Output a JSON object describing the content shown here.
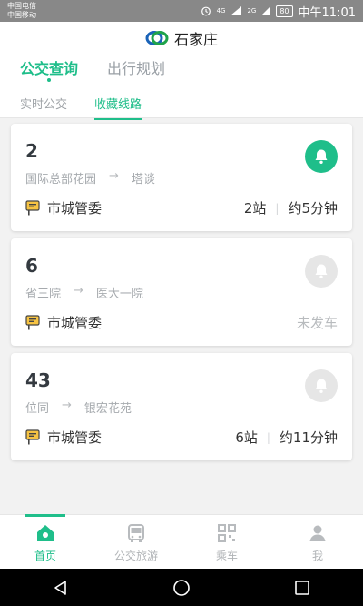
{
  "statusbar": {
    "carrier1": "中国电信",
    "carrier2": "中国移动",
    "net1": "4G",
    "net2": "2G",
    "net3": "2G",
    "battery": "80",
    "time": "中午11:01"
  },
  "header": {
    "city": "石家庄",
    "tabs": [
      {
        "label": "公交查询",
        "active": true
      },
      {
        "label": "出行规划",
        "active": false
      }
    ],
    "subtabs": [
      {
        "label": "实时公交",
        "active": false
      },
      {
        "label": "收藏线路",
        "active": true
      }
    ]
  },
  "routes": [
    {
      "number": "2",
      "from": "国际总部花园",
      "to": "塔谈",
      "arrow": "→",
      "stop": "市城管委",
      "stations": "2站",
      "time": "约5分钟",
      "reminder": "on"
    },
    {
      "number": "6",
      "from": "省三院",
      "to": "医大一院",
      "arrow": "→",
      "stop": "市城管委",
      "status": "未发车",
      "reminder": "off"
    },
    {
      "number": "43",
      "from": "位同",
      "to": "银宏花苑",
      "arrow": "→",
      "stop": "市城管委",
      "stations": "6站",
      "time": "约11分钟",
      "reminder": "off"
    }
  ],
  "bottomnav": [
    {
      "label": "首页",
      "icon": "home-icon",
      "active": true
    },
    {
      "label": "公交旅游",
      "icon": "bus-icon",
      "active": false
    },
    {
      "label": "乘车",
      "icon": "qr-code-icon",
      "active": false
    },
    {
      "label": "我",
      "icon": "user-icon",
      "active": false
    }
  ],
  "colors": {
    "accent": "#1fbe8a",
    "statusbar": "#888888"
  }
}
